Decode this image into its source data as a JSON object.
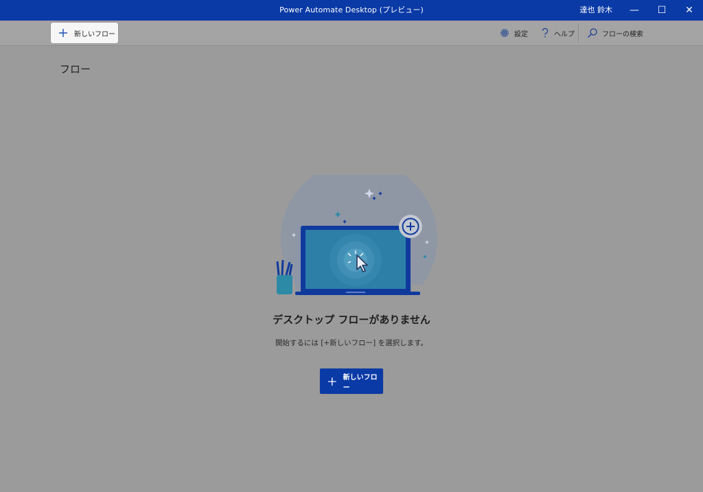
{
  "window": {
    "title": "Power Automate Desktop (プレビュー)",
    "user": "達也 鈴木",
    "controls": {
      "minimize": "—",
      "maximize": "☐",
      "close": "✕"
    }
  },
  "toolbar": {
    "new_flow_label": "新しいフロー",
    "settings_label": "設定",
    "help_label": "ヘルプ",
    "search_placeholder": "フローの検索"
  },
  "main": {
    "heading": "フロー",
    "empty_state": {
      "title": "デスクトップ フローがありません",
      "description": "開始するには [+新しいフロー] を選択します。",
      "button_label": "新しいフロー"
    }
  },
  "colors": {
    "accent": "#0a3aa6",
    "overlay_bg": "#9b9b9b",
    "toolbar_bg": "#a4a4a4"
  },
  "icons": [
    "plus-icon",
    "gear-icon",
    "help-icon",
    "search-icon",
    "minimize-icon",
    "maximize-icon",
    "close-icon"
  ]
}
